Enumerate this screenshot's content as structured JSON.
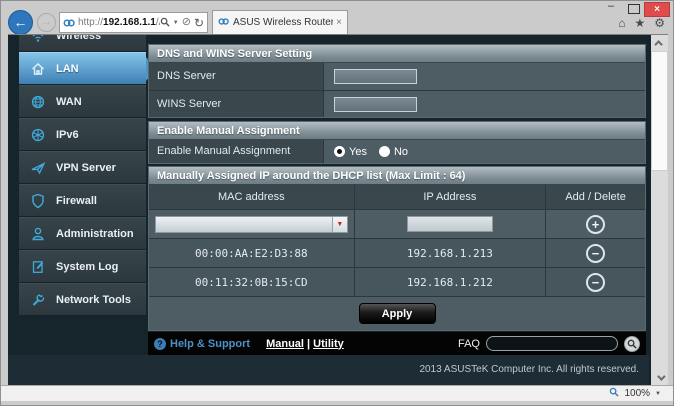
{
  "browser": {
    "url": {
      "prefix": "http://",
      "host": "192.168.1.1",
      "path": "/Advanced_I"
    },
    "tab_title": "ASUS Wireless Router RT-N...",
    "icons": {
      "back": "←",
      "forward": "→",
      "dropdown": "▼",
      "stop": "⊘",
      "refresh": "↻",
      "home": "⌂",
      "star": "★",
      "gear": "⚙",
      "close": "×",
      "tab_close": "×",
      "minimize": "–"
    }
  },
  "sidebar": {
    "items": [
      {
        "label": "Wireless",
        "active": false
      },
      {
        "label": "LAN",
        "active": true
      },
      {
        "label": "WAN",
        "active": false
      },
      {
        "label": "IPv6",
        "active": false
      },
      {
        "label": "VPN Server",
        "active": false
      },
      {
        "label": "Firewall",
        "active": false
      },
      {
        "label": "Administration",
        "active": false
      },
      {
        "label": "System Log",
        "active": false
      },
      {
        "label": "Network Tools",
        "active": false
      }
    ]
  },
  "dns_section": {
    "title": "DNS and WINS Server Setting",
    "rows": [
      {
        "label": "DNS Server",
        "value": ""
      },
      {
        "label": "WINS Server",
        "value": ""
      }
    ]
  },
  "manual_section": {
    "title": "Enable Manual Assignment",
    "row_label": "Enable Manual Assignment",
    "options": [
      "Yes",
      "No"
    ],
    "selected": "Yes"
  },
  "dhcp_section": {
    "title": "Manually Assigned IP around the DHCP list (Max Limit : 64)",
    "columns": [
      "MAC address",
      "IP Address",
      "Add / Delete"
    ],
    "add_symbol": "+",
    "delete_symbol": "−",
    "select_arrow": "▼",
    "rows": [
      {
        "mac": "00:00:AA:E2:D3:88",
        "ip": "192.168.1.213"
      },
      {
        "mac": "00:11:32:0B:15:CD",
        "ip": "192.168.1.212"
      }
    ],
    "apply_label": "Apply"
  },
  "footer": {
    "help_icon": "?",
    "help_label": "Help & Support",
    "manual_label": "Manual",
    "divider": "|",
    "utility_label": "Utility",
    "faq_label": "FAQ",
    "copyright": "2013 ASUSTeK Computer Inc. All rights reserved."
  },
  "statusbar": {
    "zoom": "100%"
  },
  "colors": {
    "accent_blue": "#41aadb",
    "active_item_top": "#83c4ea",
    "active_item_bottom": "#3e7fb4",
    "section_bg": "#4e5c63",
    "label_cell_bg": "#3a474c",
    "page_bg": "#16242c",
    "close_button": "#e04c4c"
  }
}
